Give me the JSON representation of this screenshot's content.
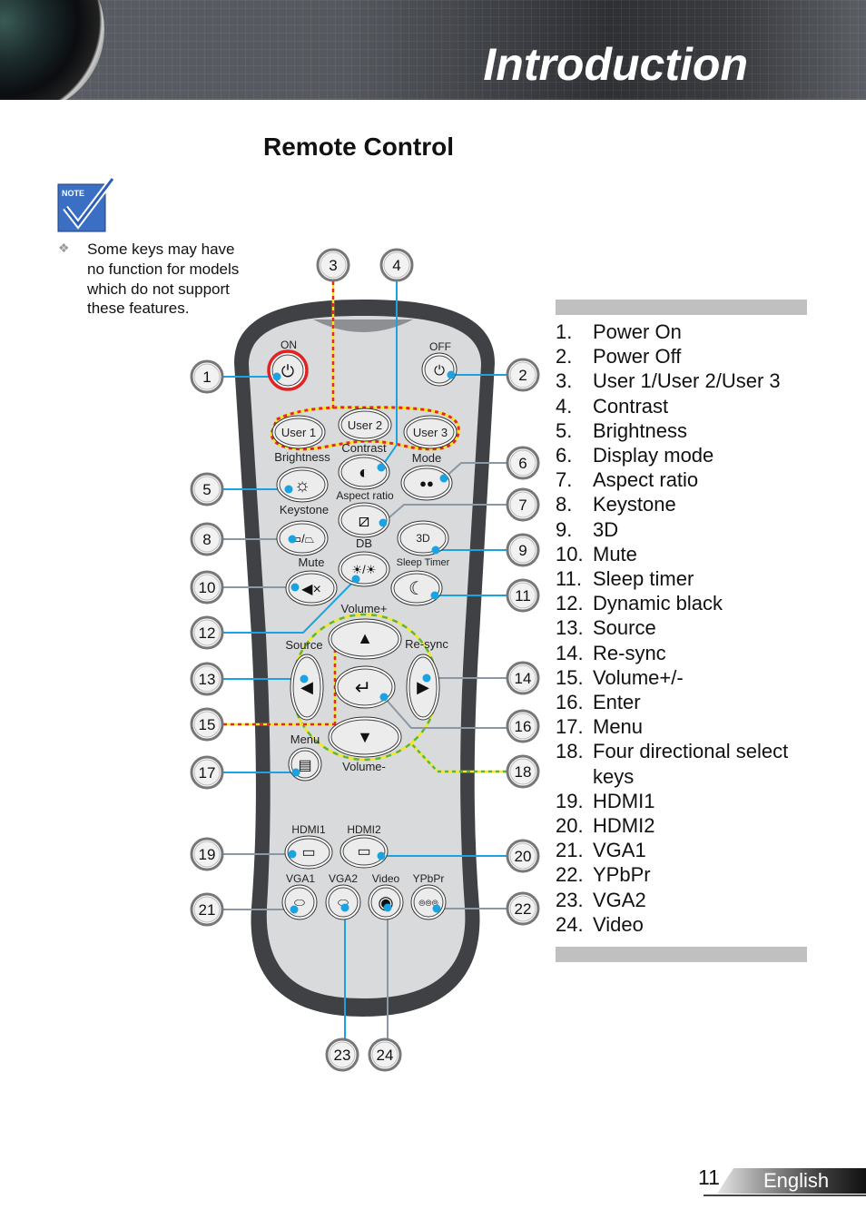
{
  "header": {
    "title": "Introduction"
  },
  "section_title": "Remote Control",
  "note": {
    "icon_label": "NOTE",
    "bullet_icon": "diamond-bullet-icon",
    "text": "Some keys may have no function for models which do not support these features."
  },
  "remote": {
    "labels": {
      "on": "ON",
      "off": "OFF",
      "user1": "User 1",
      "user2": "User 2",
      "user3": "User 3",
      "brightness": "Brightness",
      "contrast": "Contrast",
      "mode": "Mode",
      "aspect_ratio": "Aspect ratio",
      "keystone": "Keystone",
      "db": "DB",
      "three_d": "3D",
      "sleep_timer": "Sleep Timer",
      "mute": "Mute",
      "volume_up": "Volume+",
      "source": "Source",
      "resync": "Re-sync",
      "menu": "Menu",
      "volume_down": "Volume-",
      "hdmi1": "HDMI1",
      "hdmi2": "HDMI2",
      "vga1": "VGA1",
      "vga2": "VGA2",
      "video": "Video",
      "ypbpr": "YPbPr"
    },
    "callouts": [
      "1",
      "2",
      "3",
      "4",
      "5",
      "6",
      "7",
      "8",
      "9",
      "10",
      "11",
      "12",
      "13",
      "14",
      "15",
      "16",
      "17",
      "18",
      "19",
      "20",
      "21",
      "22",
      "23",
      "24"
    ],
    "colors": {
      "leader_blue": "#1aa3e0",
      "leader_gray": "#8a98a6",
      "highlight_red": "#e8262a",
      "highlight_yellow": "#f4e81c",
      "highlight_green": "#5bb63a",
      "power_ring": "#e02424"
    }
  },
  "legend": [
    {
      "num": "1.",
      "label": "Power On"
    },
    {
      "num": "2.",
      "label": "Power Off"
    },
    {
      "num": "3.",
      "label": "User 1/User 2/User 3"
    },
    {
      "num": "4.",
      "label": "Contrast"
    },
    {
      "num": "5.",
      "label": "Brightness"
    },
    {
      "num": "6.",
      "label": "Display mode"
    },
    {
      "num": "7.",
      "label": "Aspect ratio"
    },
    {
      "num": "8.",
      "label": "Keystone"
    },
    {
      "num": "9.",
      "label": "3D"
    },
    {
      "num": "10.",
      "label": "Mute"
    },
    {
      "num": "11.",
      "label": "Sleep timer"
    },
    {
      "num": "12.",
      "label": "Dynamic black"
    },
    {
      "num": "13.",
      "label": "Source"
    },
    {
      "num": "14.",
      "label": "Re-sync"
    },
    {
      "num": "15.",
      "label": "Volume+/-"
    },
    {
      "num": "16.",
      "label": "Enter"
    },
    {
      "num": "17.",
      "label": "Menu"
    },
    {
      "num": "18.",
      "label": "Four directional select keys"
    },
    {
      "num": "19.",
      "label": "HDMI1"
    },
    {
      "num": "20.",
      "label": "HDMI2"
    },
    {
      "num": "21.",
      "label": "VGA1"
    },
    {
      "num": "22.",
      "label": "YPbPr"
    },
    {
      "num": "23.",
      "label": "VGA2"
    },
    {
      "num": "24.",
      "label": "Video"
    }
  ],
  "footer": {
    "page_number": "11",
    "language": "English"
  }
}
